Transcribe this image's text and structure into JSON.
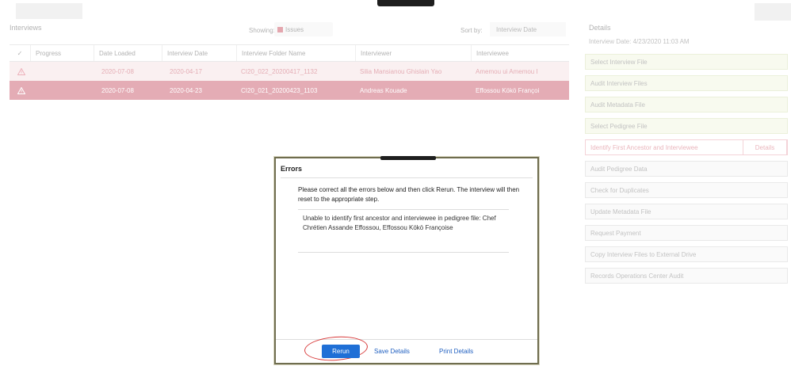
{
  "interviews": {
    "title": "Interviews",
    "showing_label": "Showing:",
    "showing_value": "Issues",
    "sort_label": "Sort by:",
    "sort_value": "Interview Date",
    "columns": [
      "✓",
      "Progress",
      "Date Loaded",
      "Interview Date",
      "Interview Folder Name",
      "Interviewer",
      "Interviewee"
    ],
    "rows": [
      {
        "status_icon": "warning-icon",
        "progress": "",
        "date_loaded": "2020-07-08",
        "interview_date": "2020-04-17",
        "folder": "CI20_022_20200417_1132",
        "interviewer": "Silia Mansianou Ghislain Yao",
        "interviewee": "Amemou ui Amemou I"
      },
      {
        "status_icon": "warning-icon",
        "progress": "",
        "date_loaded": "2020-07-08",
        "interview_date": "2020-04-23",
        "folder": "CI20_021_20200423_1103",
        "interviewer": "Andreas Kouade",
        "interviewee": "Effossou Kökö Françoi"
      }
    ]
  },
  "details": {
    "title": "Details",
    "interview_date": "Interview Date: 4/23/2020 11:03 AM",
    "details_button": "Details",
    "steps": [
      {
        "label": "Select Interview File",
        "state": "done"
      },
      {
        "label": "Audit Interview Files",
        "state": "done"
      },
      {
        "label": "Audit Metadata File",
        "state": "done"
      },
      {
        "label": "Select Pedigree File",
        "state": "done"
      },
      {
        "label": "Identify First Ancestor and Interviewee",
        "state": "error"
      },
      {
        "label": "Audit Pedigree Data",
        "state": "pending"
      },
      {
        "label": "Check for Duplicates",
        "state": "pending"
      },
      {
        "label": "Update Metadata File",
        "state": "pending"
      },
      {
        "label": "Request Payment",
        "state": "pending"
      },
      {
        "label": "Copy Interview Files to External Drive",
        "state": "pending"
      },
      {
        "label": "Records Operations Center Audit",
        "state": "pending"
      }
    ]
  },
  "dialog": {
    "title": "Errors",
    "instructions": "Please correct all the errors below and then click Rerun. The interview will then reset to the appropriate step.",
    "message": "Unable to identify first ancestor and interviewee in pedigree file: Chef Chrétien Assande Effossou, Effossou Kökö Françoise",
    "rerun": "Rerun",
    "save": "Save Details",
    "print": "Print Details"
  },
  "colors": {
    "error_row": "#c5485c",
    "error_row_light": "#f6dfe2",
    "step_done": "#f1f5dc",
    "primary_button": "#1f6fd6",
    "annotation_ring": "#d83a3a"
  }
}
